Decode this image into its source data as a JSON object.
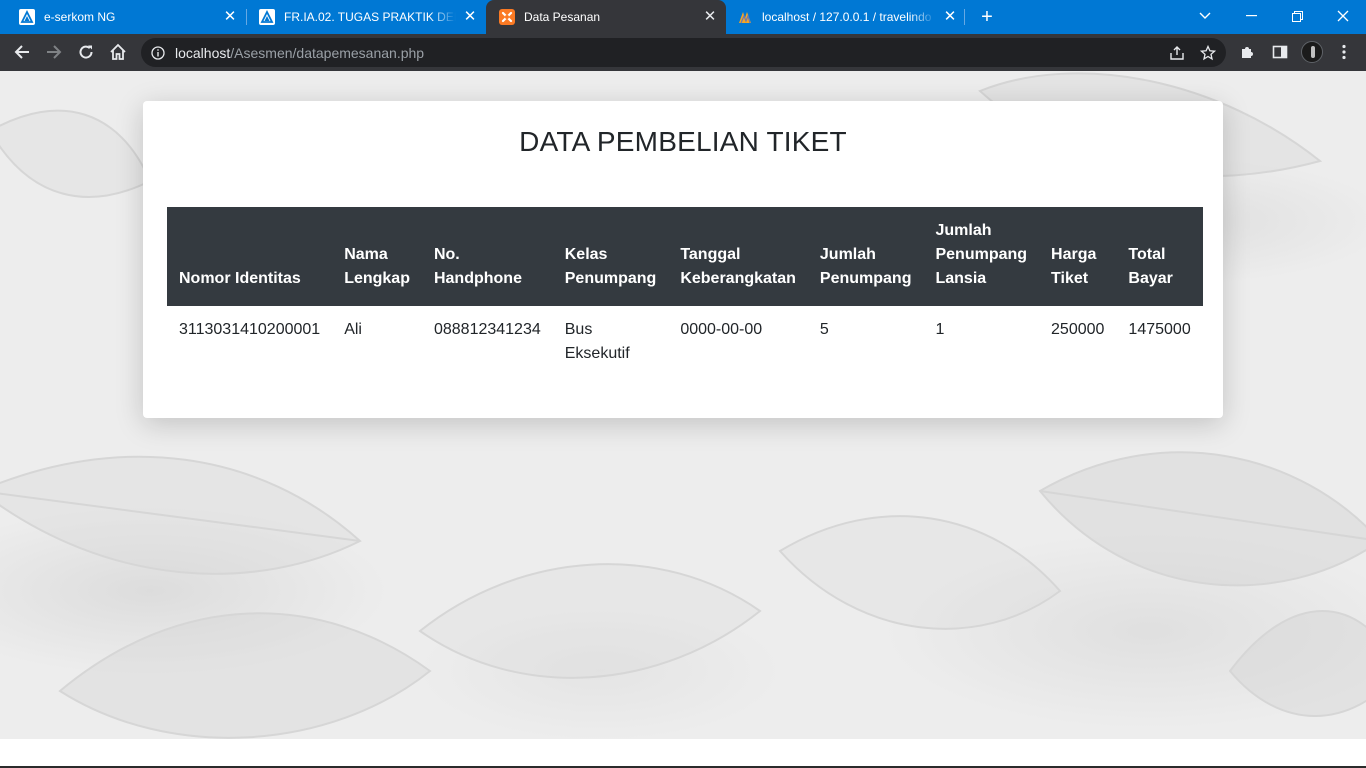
{
  "browser": {
    "tabs": [
      {
        "title": "e-serkom NG",
        "icon": "triangle-logo-icon",
        "active": false
      },
      {
        "title": "FR.IA.02. TUGAS PRAKTIK DEMONSTRASI",
        "icon": "triangle-logo-icon",
        "active": false
      },
      {
        "title": "Data Pesanan",
        "icon": "xampp-icon",
        "active": true
      },
      {
        "title": "localhost / 127.0.0.1 / travelindo",
        "icon": "phpmyadmin-icon",
        "active": false
      }
    ],
    "new_tab_label": "+",
    "address": {
      "host": "localhost",
      "path": "/Asesmen/datapemesanan.php"
    }
  },
  "page": {
    "title": "DATA PEMBELIAN TIKET",
    "table": {
      "headers": [
        "Nomor Identitas",
        "Nama Lengkap",
        "No. Handphone",
        "Kelas Penumpang",
        "Tanggal Keberangkatan",
        "Jumlah Penumpang",
        "Jumlah Penumpang Lansia",
        "Harga Tiket",
        "Total Bayar"
      ],
      "rows": [
        [
          "3113031410200001",
          "Ali",
          "088812341234",
          "Bus Eksekutif",
          "0000-00-00",
          "5",
          "1",
          "250000",
          "1475000"
        ]
      ]
    }
  },
  "colors": {
    "tabstrip": "#0078d4",
    "toolbar": "#35363a",
    "table_header": "#343a40"
  }
}
